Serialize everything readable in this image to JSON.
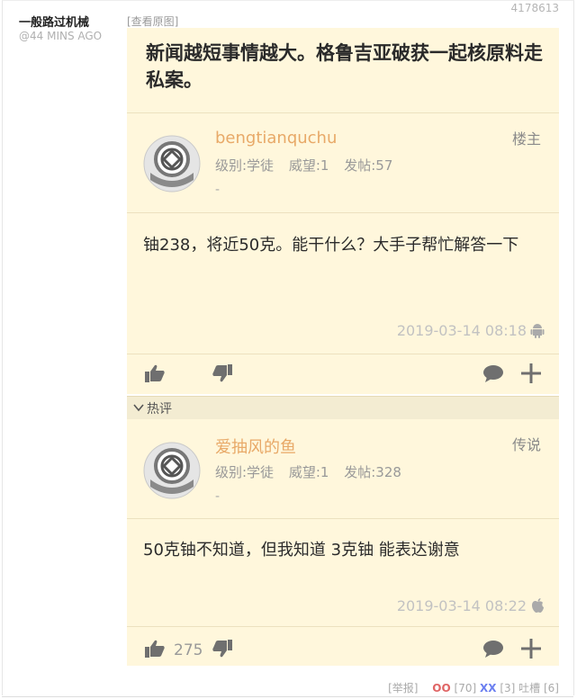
{
  "post": {
    "author": "一般路过机械",
    "time": "@44 MINS AGO",
    "view_source": "[查看原图]",
    "id": "4178613",
    "headline": "新闻越短事情越大。格鲁吉亚破获一起核原料走私案。"
  },
  "comment_main": {
    "username": "bengtianquchu",
    "role": "楼主",
    "level": "级别:学徒",
    "prestige": "威望:1",
    "posts": "发帖:57",
    "dash": "-",
    "content": "铀238，将近50克。能干什么？大手子帮忙解答一下",
    "timestamp": "2019-03-14 08:18",
    "os_icon": "android-icon",
    "likes": ""
  },
  "hot": {
    "label": "热评"
  },
  "comment_hot": {
    "username": "爱抽风的鱼",
    "role": "传说",
    "level": "级别:学徒",
    "prestige": "威望:1",
    "posts": "发帖:328",
    "dash": "-",
    "content": "50克铀不知道，但我知道 3克铀 能表达谢意",
    "timestamp": "2019-03-14 08:22",
    "os_icon": "apple-icon",
    "likes": "275"
  },
  "footer": {
    "report": "[举报]",
    "oo_label": "OO",
    "oo_count": "[70]",
    "xx_label": "XX",
    "xx_count": "[3]",
    "tucao": "吐槽 [6]"
  },
  "colors": {
    "card_bg": "#fff7dc",
    "username": "#e8a968",
    "oo": "#e06565",
    "xx": "#6b7ff0"
  }
}
